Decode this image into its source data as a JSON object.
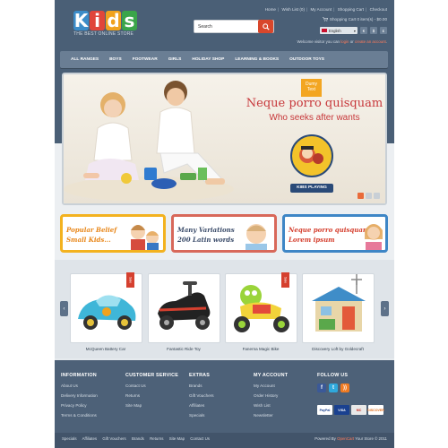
{
  "logo": {
    "letters": [
      "K",
      "i",
      "d",
      "s"
    ],
    "letter_colors": [
      "#3c8cc8",
      "#e0463a",
      "#f0a21e",
      "#3aa54a"
    ],
    "tagline": "THE BEST ONLINE STORE"
  },
  "header": {
    "top_links": [
      "Home",
      "Wish List (0)",
      "My Account",
      "Shopping Cart",
      "Checkout"
    ],
    "cart_text": "Shopping Cart 0 item(s) - $0.00",
    "language": "English",
    "currencies": [
      "€",
      "$",
      "£"
    ],
    "welcome_prefix": "Welcome visitor you can",
    "login_label": "login",
    "welcome_or": "or",
    "register_label": "create an account",
    "welcome_suffix": "."
  },
  "search": {
    "value": "Search",
    "button_icon": "search-icon"
  },
  "nav": {
    "items": [
      "ALL RANGES",
      "BOYS",
      "FOOTWEAR",
      "GIRLS",
      "HOLIDAY SHOP",
      "LEARNING & BOOKS",
      "OUTDOOR TOYS"
    ]
  },
  "slider": {
    "badge": "Dumy Text",
    "heading": "Neque porro quisquam",
    "subheading": "Who seeks after wants",
    "logo_label": "KIBS PLAYING",
    "active_slide": 1,
    "slide_count": 3
  },
  "promos": [
    {
      "line1": "Popular Belief",
      "line2": "Small Kids...",
      "border": "#f3b21f",
      "color": "#e8871a"
    },
    {
      "line1": "Many Variations",
      "line2": "200 Latin words",
      "border": "#d8685a",
      "color": "#3b4c6a"
    },
    {
      "line1": "Neque porro quisquam",
      "line2": "Lorem ipsum",
      "border": "#3e86c6",
      "color": "#d5402f"
    }
  ],
  "featured": {
    "sale_label": "Sale",
    "products": [
      {
        "name": "McQueen Battery Car"
      },
      {
        "name": "Fantastic Ride Toy"
      },
      {
        "name": "Fanerna Magic Bike"
      },
      {
        "name": "Discovery Loft by Goldecraft"
      }
    ],
    "prev_icon": "chevron-left-icon",
    "next_icon": "chevron-right-icon"
  },
  "footer": {
    "columns": [
      {
        "title": "INFORMATION",
        "links": [
          "About Us",
          "Delivery Information",
          "Privacy Policy",
          "Terms & Conditions"
        ]
      },
      {
        "title": "CUSTOMER SERVICE",
        "links": [
          "Contact Us",
          "Returns",
          "Site Map"
        ]
      },
      {
        "title": "EXTRAS",
        "links": [
          "Brands",
          "Gift Vouchers",
          "Affiliates",
          "Specials"
        ]
      },
      {
        "title": "MY ACCOUNT",
        "links": [
          "My Account",
          "Order History",
          "Wish List",
          "Newsletter"
        ]
      }
    ],
    "follow_title": "FOLLOW US",
    "social": [
      {
        "name": "facebook-icon",
        "glyph": "f",
        "color": "#3b5998"
      },
      {
        "name": "twitter-icon",
        "glyph": "t",
        "color": "#2fa8dc"
      },
      {
        "name": "rss-icon",
        "glyph": "r",
        "color": "#f07b22"
      }
    ],
    "payments": [
      "PayPal",
      "VISA",
      "MC",
      "DISCOVER"
    ],
    "bottom_links": [
      "Specials",
      "Affiliates",
      "Gift Vouchers",
      "Brands",
      "Returns",
      "Site Map",
      "Contact Us"
    ],
    "powered_prefix": "Powered By",
    "powered_link": "OpenCart",
    "powered_suffix": "Your Store © 2011"
  }
}
